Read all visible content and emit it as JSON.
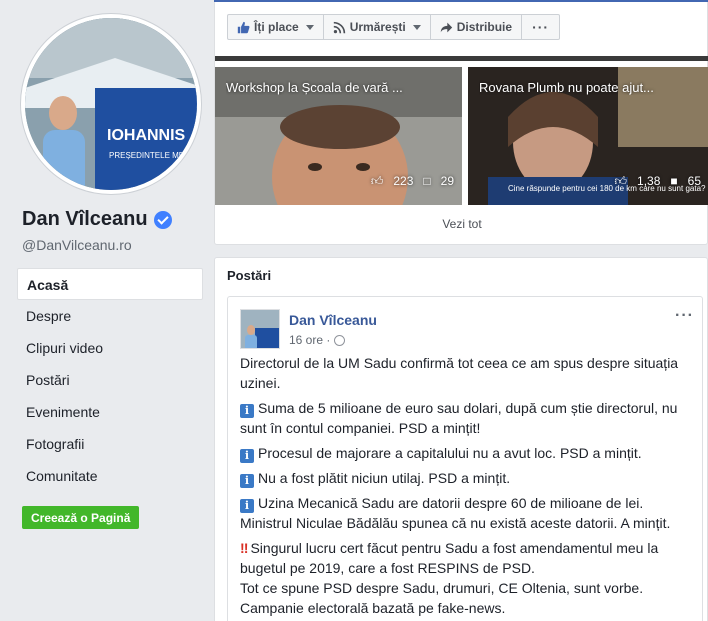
{
  "profile": {
    "name": "Dan Vîlceanu",
    "handle": "@DanVilceanu.ro",
    "avatar_banner_text": "IOHANNIS",
    "avatar_banner_sub": "PREȘEDINTELE MEU"
  },
  "nav": {
    "items": [
      {
        "label": "Acasă"
      },
      {
        "label": "Despre"
      },
      {
        "label": "Clipuri video"
      },
      {
        "label": "Postări"
      },
      {
        "label": "Evenimente"
      },
      {
        "label": "Fotografii"
      },
      {
        "label": "Comunitate"
      }
    ],
    "create_page": "Creează o Pagină"
  },
  "actions": {
    "like": "Îți place",
    "follow": "Urmărești",
    "share": "Distribuie",
    "more": "···"
  },
  "videos": [
    {
      "title": "Workshop la Școala de vară ...",
      "likes": "223",
      "comments": "29"
    },
    {
      "title": "Rovana Plumb nu poate ajut...",
      "likes": "1,38",
      "comments": "65",
      "caption": "Cine răspunde pentru cei 180 de km care nu sunt gata?"
    }
  ],
  "see_all": "Vezi tot",
  "posts": {
    "title": "Postări",
    "post": {
      "author": "Dan Vîlceanu",
      "time": "16 ore ·",
      "more": "···",
      "p1": "Directorul de la UM Sadu confirmă tot ceea ce am spus despre situația uzinei.",
      "p2": "Suma de 5 milioane de euro sau dolari, după cum știe directorul, nu sunt în contul companiei. PSD a mințit!",
      "p3": "Procesul de majorare a capitalului nu a avut loc. PSD a mințit.",
      "p4": "Nu a fost plătit niciun utilaj. PSD a mințit.",
      "p5": "Uzina Mecanică Sadu are datorii despre 60 de milioane de lei. Ministrul Niculae Bădălău spunea că nu există aceste datorii. A mințit.",
      "p6": "Singurul lucru cert făcut pentru Sadu a fost amendamentul meu la bugetul pe 2019, care a fost RESPINS de PSD.",
      "p7": "Tot ce spune PSD despre Sadu, drumuri, CE Oltenia, sunt vorbe.",
      "p8": "Campanie electorală bazată pe fake-news.",
      "info_icon": "i",
      "excl_icon": "‼"
    }
  }
}
